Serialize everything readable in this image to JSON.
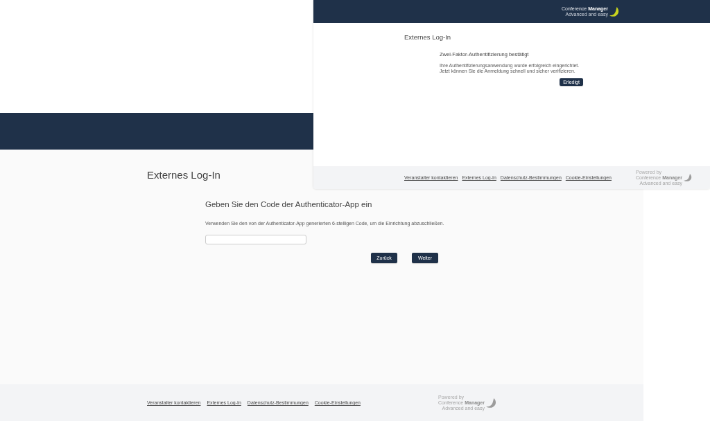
{
  "confirmation_window": {
    "header": {
      "logo": {
        "name": "Conference **Manager**",
        "tagline": "Advanced and easy"
      }
    },
    "page_title": "Externes Log-In",
    "heading": "Zwei-Faktor-Authentifizierung bestätigt",
    "message": "Ihre Authentifizierungsanwendung wurde erfolgreich eingerichtet.\nJetzt können Sie die Anmeldung schnell und sicher verifizieren.",
    "button": "Erledigt",
    "footer": {
      "links": [
        "Veranstalter kontaktieren",
        "Externes Log-In",
        "Datenschutz-Bestimmungen",
        "Cookie-Einstellungen"
      ],
      "logo": {
        "powered_by": "Powered by",
        "name": "Conference **Manager**",
        "tagline": "Advanced and easy"
      }
    }
  },
  "code_entry_window": {
    "page_title": "Externes Log-In",
    "heading": "Geben Sie den Code der Authenticator-App ein",
    "instruction": "Verwenden Sie den von der Authenticator-App generierten 6-stelligen Code, um die Einrichtung abzuschließen.",
    "buttons": [
      "Zurück",
      "Weiter"
    ],
    "footer": {
      "links": [
        "Veranstalter kontaktieren",
        "Externes Log-In",
        "Datenschutz-Bestimmungen",
        "Cookie-Einstellungen"
      ],
      "logo": {
        "powered_by": "Powered by",
        "name": "Conference **Manager**",
        "tagline": "Advanced and easy"
      }
    }
  }
}
